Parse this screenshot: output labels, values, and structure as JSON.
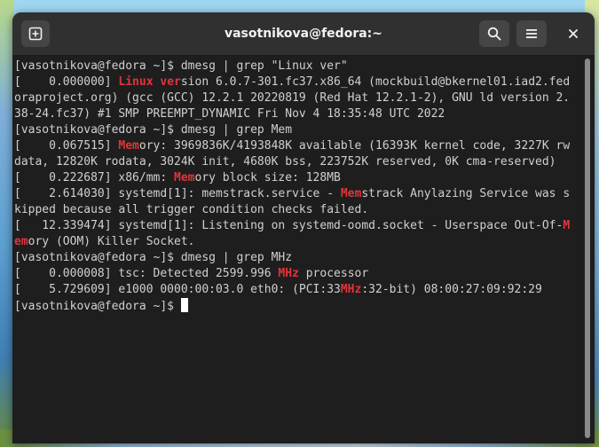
{
  "window": {
    "title": "vasotnikova@fedora:~",
    "icons": {
      "new_tab": "new-tab-icon",
      "search": "search-icon",
      "menu": "hamburger-menu-icon",
      "close": "close-icon"
    }
  },
  "terminal": {
    "highlight_color": "#e0353a",
    "lines": [
      [
        {
          "t": "[vasotnikova@fedora ~]$ dmesg | grep \"Linux ver\""
        }
      ],
      [
        {
          "t": "[    0.000000] "
        },
        {
          "t": "Linux ver",
          "h": true
        },
        {
          "t": "sion 6.0.7-301.fc37.x86_64 (mockbuild@bkernel01.iad2.fed"
        }
      ],
      [
        {
          "t": "oraproject.org) (gcc (GCC) 12.2.1 20220819 (Red Hat 12.2.1-2), GNU ld version 2."
        }
      ],
      [
        {
          "t": "38-24.fc37) #1 SMP PREEMPT_DYNAMIC Fri Nov 4 18:35:48 UTC 2022"
        }
      ],
      [
        {
          "t": "[vasotnikova@fedora ~]$ dmesg | grep Mem"
        }
      ],
      [
        {
          "t": "[    0.067515] "
        },
        {
          "t": "Mem",
          "h": true
        },
        {
          "t": "ory: 3969836K/4193848K available (16393K kernel code, 3227K rw"
        }
      ],
      [
        {
          "t": "data, 12820K rodata, 3024K init, 4680K bss, 223752K reserved, 0K cma-reserved)"
        }
      ],
      [
        {
          "t": "[    0.222687] x86/mm: "
        },
        {
          "t": "Mem",
          "h": true
        },
        {
          "t": "ory block size: 128MB"
        }
      ],
      [
        {
          "t": "[    2.614030] systemd[1]: memstrack.service - "
        },
        {
          "t": "Mem",
          "h": true
        },
        {
          "t": "strack Anylazing Service was s"
        }
      ],
      [
        {
          "t": "kipped because all trigger condition checks failed."
        }
      ],
      [
        {
          "t": "[   12.339474] systemd[1]: Listening on systemd-oomd.socket - Userspace Out-Of-"
        },
        {
          "t": "M",
          "h": true
        }
      ],
      [
        {
          "t": "em",
          "h": true
        },
        {
          "t": "ory (OOM) Killer Socket."
        }
      ],
      [
        {
          "t": "[vasotnikova@fedora ~]$ dmesg | grep MHz"
        }
      ],
      [
        {
          "t": "[    0.000008] tsc: Detected 2599.996 "
        },
        {
          "t": "MHz",
          "h": true
        },
        {
          "t": " processor"
        }
      ],
      [
        {
          "t": "[    5.729609] e1000 0000:00:03.0 eth0: (PCI:33"
        },
        {
          "t": "MHz",
          "h": true
        },
        {
          "t": ":32-bit) 08:00:27:09:92:29"
        }
      ],
      [
        {
          "t": "[vasotnikova@fedora ~]$ "
        },
        {
          "cursor": true
        }
      ]
    ]
  }
}
